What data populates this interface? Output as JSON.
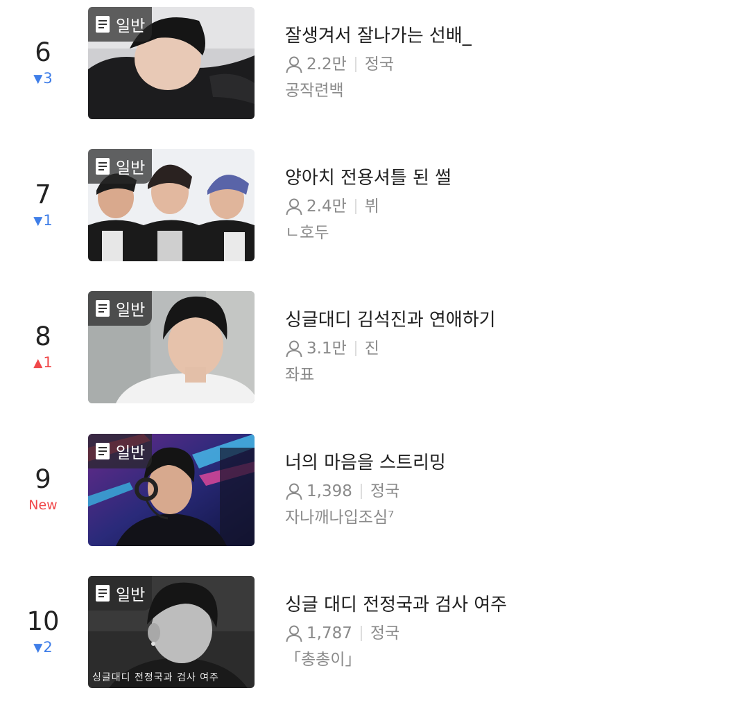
{
  "items": [
    {
      "rank": "6",
      "change_dir": "down",
      "change_arrow": "▼",
      "change_value": "3",
      "badge_icon": "document-icon",
      "badge": "일반",
      "title": "잘생겨서 잘나가는 선배_",
      "views": "2.2만",
      "member": "정국",
      "author": "공작련백"
    },
    {
      "rank": "7",
      "change_dir": "down",
      "change_arrow": "▼",
      "change_value": "1",
      "badge_icon": "document-icon",
      "badge": "일반",
      "title": "양아치 전용셔틀 된 썰",
      "views": "2.4만",
      "member": "뷔",
      "author": "ㄴ호두"
    },
    {
      "rank": "8",
      "change_dir": "up",
      "change_arrow": "▲",
      "change_value": "1",
      "badge_icon": "document-icon",
      "badge": "일반",
      "title": "싱글대디 김석진과 연애하기",
      "views": "3.1만",
      "member": "진",
      "author": "좌표"
    },
    {
      "rank": "9",
      "change_dir": "new",
      "change_arrow": "",
      "change_value": "New",
      "badge_icon": "document-icon",
      "badge": "일반",
      "title": "너의 마음을 스트리밍",
      "views": "1,398",
      "member": "정국",
      "author": "자나깨나입조심⁷"
    },
    {
      "rank": "10",
      "change_dir": "down",
      "change_arrow": "▼",
      "change_value": "2",
      "badge_icon": "document-icon",
      "badge": "일반",
      "title": "싱글 대디 전정국과 검사 여주",
      "views": "1,787",
      "member": "정국",
      "author": "「총총이」",
      "thumb_caption": "싱글대디 전정국과 검사 여주"
    }
  ],
  "icons": {
    "views": "person-icon"
  },
  "colors": {
    "rank_down": "#3f7ee8",
    "rank_up": "#f0484a",
    "rank_new": "#f0484a",
    "meta_text": "#8a8a8a"
  }
}
